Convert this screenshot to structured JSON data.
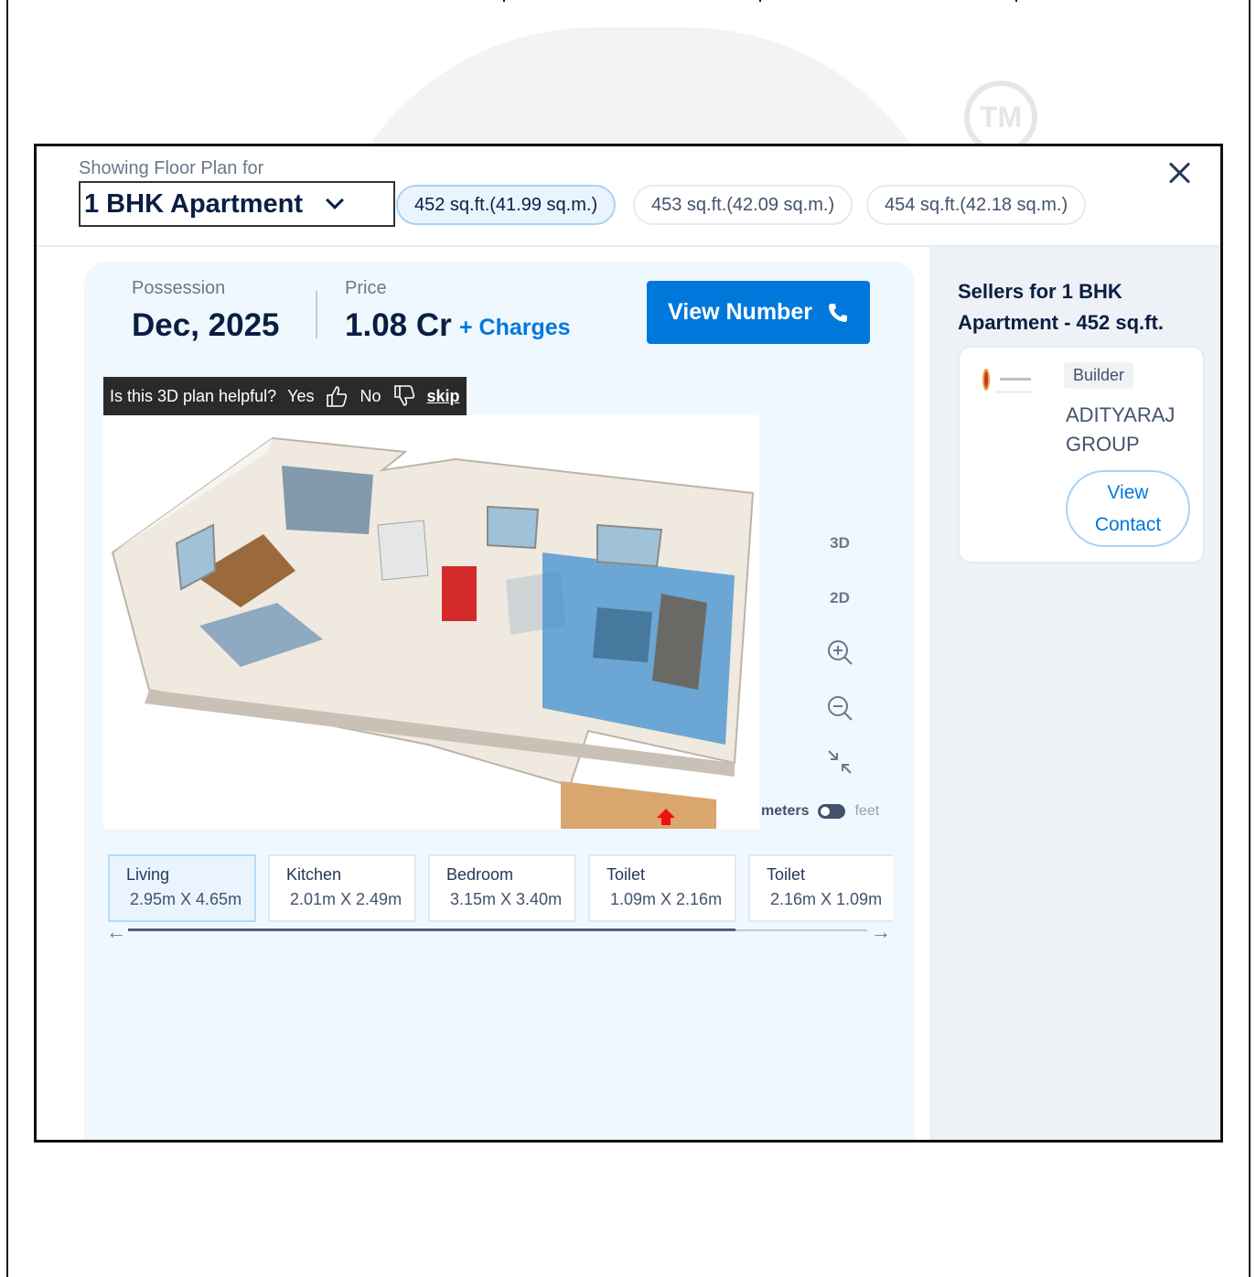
{
  "header": {
    "showing_label": "Showing Floor Plan for",
    "selected_config": "1 BHK Apartment",
    "area_options": [
      "452 sq.ft.(41.99 sq.m.)",
      "453 sq.ft.(42.09 sq.m.)",
      "454 sq.ft.(42.18 sq.m.)"
    ],
    "active_area_index": 0
  },
  "summary": {
    "possession_label": "Possession",
    "possession_value": "Dec, 2025",
    "price_label": "Price",
    "price_value": "1.08 Cr",
    "charges_link": "+ Charges",
    "view_number_label": "View Number"
  },
  "feedback": {
    "question": "Is this 3D plan helpful?",
    "yes": "Yes",
    "no": "No",
    "skip": "skip"
  },
  "view_controls": {
    "view_3d": "3D",
    "view_2d": "2D",
    "unit_meters": "meters",
    "unit_feet": "feet",
    "selected_unit": "meters"
  },
  "rooms": [
    {
      "name": "Living",
      "dims": "2.95m X 4.65m"
    },
    {
      "name": "Kitchen",
      "dims": "2.01m X 2.49m"
    },
    {
      "name": "Bedroom",
      "dims": "3.15m X 3.40m"
    },
    {
      "name": "Toilet",
      "dims": "1.09m X 2.16m"
    },
    {
      "name": "Toilet",
      "dims": "2.16m X 1.09m"
    }
  ],
  "sellers": {
    "heading": "Sellers for 1 BHK Apartment - 452 sq.ft.",
    "seller": {
      "badge": "Builder",
      "name": "ADITYARAJ GROUP",
      "contact_label": "View Contact"
    }
  },
  "colors": {
    "accent": "#0078db",
    "panel_bg": "#f0f8ff",
    "side_bg": "#eef1f5"
  }
}
